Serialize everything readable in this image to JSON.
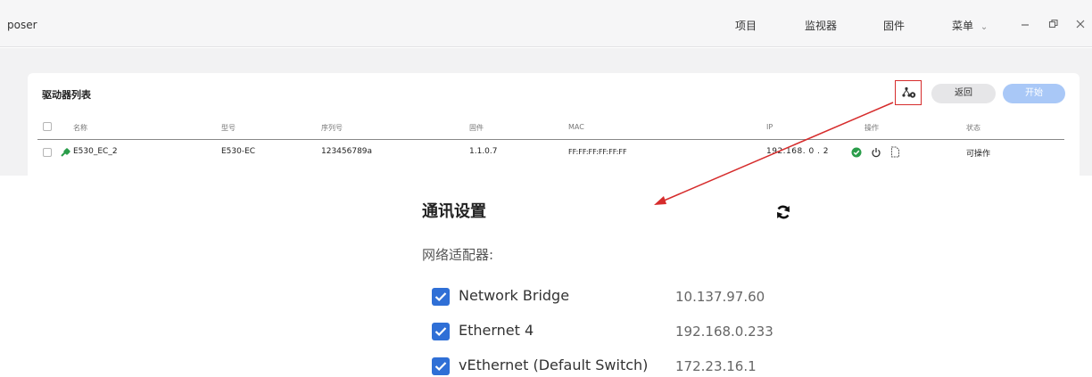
{
  "window": {
    "title": "poser",
    "menu": [
      "项目",
      "监视器",
      "固件",
      "菜单"
    ],
    "menu_caret": "⌄",
    "controls": [
      "minimize-icon",
      "restore-icon",
      "close-icon"
    ]
  },
  "drive_list": {
    "title": "驱动器列表",
    "back_label": "返回",
    "start_label": "开始",
    "columns": [
      "名称",
      "型号",
      "序列号",
      "固件",
      "MAC",
      "IP",
      "操作",
      "状态"
    ],
    "rows": [
      {
        "name": "E530_EC_2",
        "model": "E530-EC",
        "serial": "123456789a",
        "firmware": "1.1.0.7",
        "mac": "FF:FF:FF:FF:FF:FF",
        "ip": "192.168. 0 . 2",
        "status": "可操作"
      }
    ]
  },
  "comm_settings": {
    "title": "通讯设置",
    "adapter_label": "网络适配器:",
    "adapters": [
      {
        "name": "Network Bridge",
        "ip": "10.137.97.60",
        "checked": true
      },
      {
        "name": "Ethernet 4",
        "ip": "192.168.0.233",
        "checked": true
      },
      {
        "name": "vEthernet (Default Switch)",
        "ip": "172.23.16.1",
        "checked": true
      }
    ]
  },
  "colors": {
    "accent_blue": "#2f6fd6",
    "start_button": "#a9c8f7",
    "highlight_red": "#d62c2c",
    "status_green": "#2a9d4a"
  }
}
